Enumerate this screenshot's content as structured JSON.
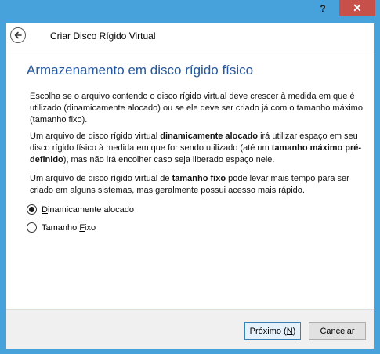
{
  "titlebar": {
    "help_glyph": "?",
    "close_glyph": "✕"
  },
  "header": {
    "back_icon": "back-arrow-icon",
    "title": "Criar Disco Rígido Virtual"
  },
  "content": {
    "section_title": "Armazenamento em disco rígido físico",
    "p1": "Escolha se o arquivo contendo o disco rígido virtual deve crescer à medida em que é utilizado (dinamicamente alocado) ou se ele deve ser criado já com o tamanho máximo (tamanho fixo).",
    "p2_a": "Um arquivo de disco rígido virtual ",
    "p2_b": "dinamicamente alocado",
    "p2_c": " irá utilizar espaço em seu disco rígido físico à medida em que for sendo utilizado (até um ",
    "p2_d": "tamanho máximo pré-definido",
    "p2_e": "), mas não irá encolher caso seja liberado espaço nele.",
    "p3_a": "Um arquivo de disco rígido virtual de ",
    "p3_b": "tamanho fixo",
    "p3_c": " pode levar mais tempo para ser criado em alguns sistemas, mas geralmente possui acesso mais rápido.",
    "options": [
      {
        "label_pre": "",
        "mnemonic": "D",
        "label_post": "inamicamente alocado",
        "selected": true
      },
      {
        "label_pre": "Tamanho ",
        "mnemonic": "F",
        "label_post": "ixo",
        "selected": false
      }
    ]
  },
  "footer": {
    "next_pre": "Próximo (",
    "next_mnemonic": "N",
    "next_post": ")",
    "cancel_label": "Cancelar"
  },
  "colors": {
    "frame": "#47a1db",
    "close": "#c7504a",
    "section_title": "#24579d"
  }
}
